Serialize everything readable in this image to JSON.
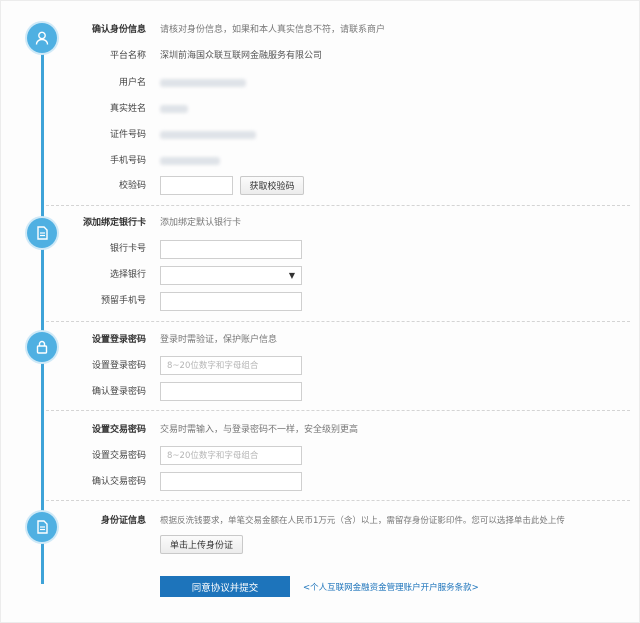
{
  "identity": {
    "title": "确认身份信息",
    "hint": "请核对身份信息，如果和本人真实信息不符，请联系商户",
    "platform_label": "平台名称",
    "platform_value": "深圳前海国众联互联网金融服务有限公司",
    "username_label": "用户名",
    "realname_label": "真实姓名",
    "id_label": "证件号码",
    "phone_label": "手机号码",
    "code_label": "校验码",
    "get_code_button": "获取校验码"
  },
  "bank": {
    "title": "添加绑定银行卡",
    "hint": "添加绑定默认银行卡",
    "card_label": "银行卡号",
    "select_label": "选择银行",
    "caret": "▼",
    "phone_label": "预留手机号"
  },
  "login_password": {
    "title": "设置登录密码",
    "hint": "登录时需验证，保护账户信息",
    "set_label": "设置登录密码",
    "set_placeholder": "8~20位数字和字母组合",
    "confirm_label": "确认登录密码"
  },
  "trade_password": {
    "title": "设置交易密码",
    "hint": "交易时需输入，与登录密码不一样，安全级别更高",
    "set_label": "设置交易密码",
    "set_placeholder": "8~20位数字和字母组合",
    "confirm_label": "确认交易密码"
  },
  "id_card": {
    "title": "身份证信息",
    "hint": "根据反洗钱要求，单笔交易金额在人民币1万元（含）以上，需留存身份证影印件。您可以选择单击此处上传",
    "upload_button": "单击上传身份证"
  },
  "footer": {
    "submit_button": "同意协议并提交",
    "agreement_link": "<个人互联网金融资金管理账户开户服务条款>"
  },
  "colors": {
    "accent": "#4fb0e2",
    "timeline": "#3ea3d8",
    "primary_button": "#1d74bb"
  },
  "icons": [
    "user-icon",
    "bankcard-icon",
    "lock-icon",
    "idcard-icon"
  ]
}
